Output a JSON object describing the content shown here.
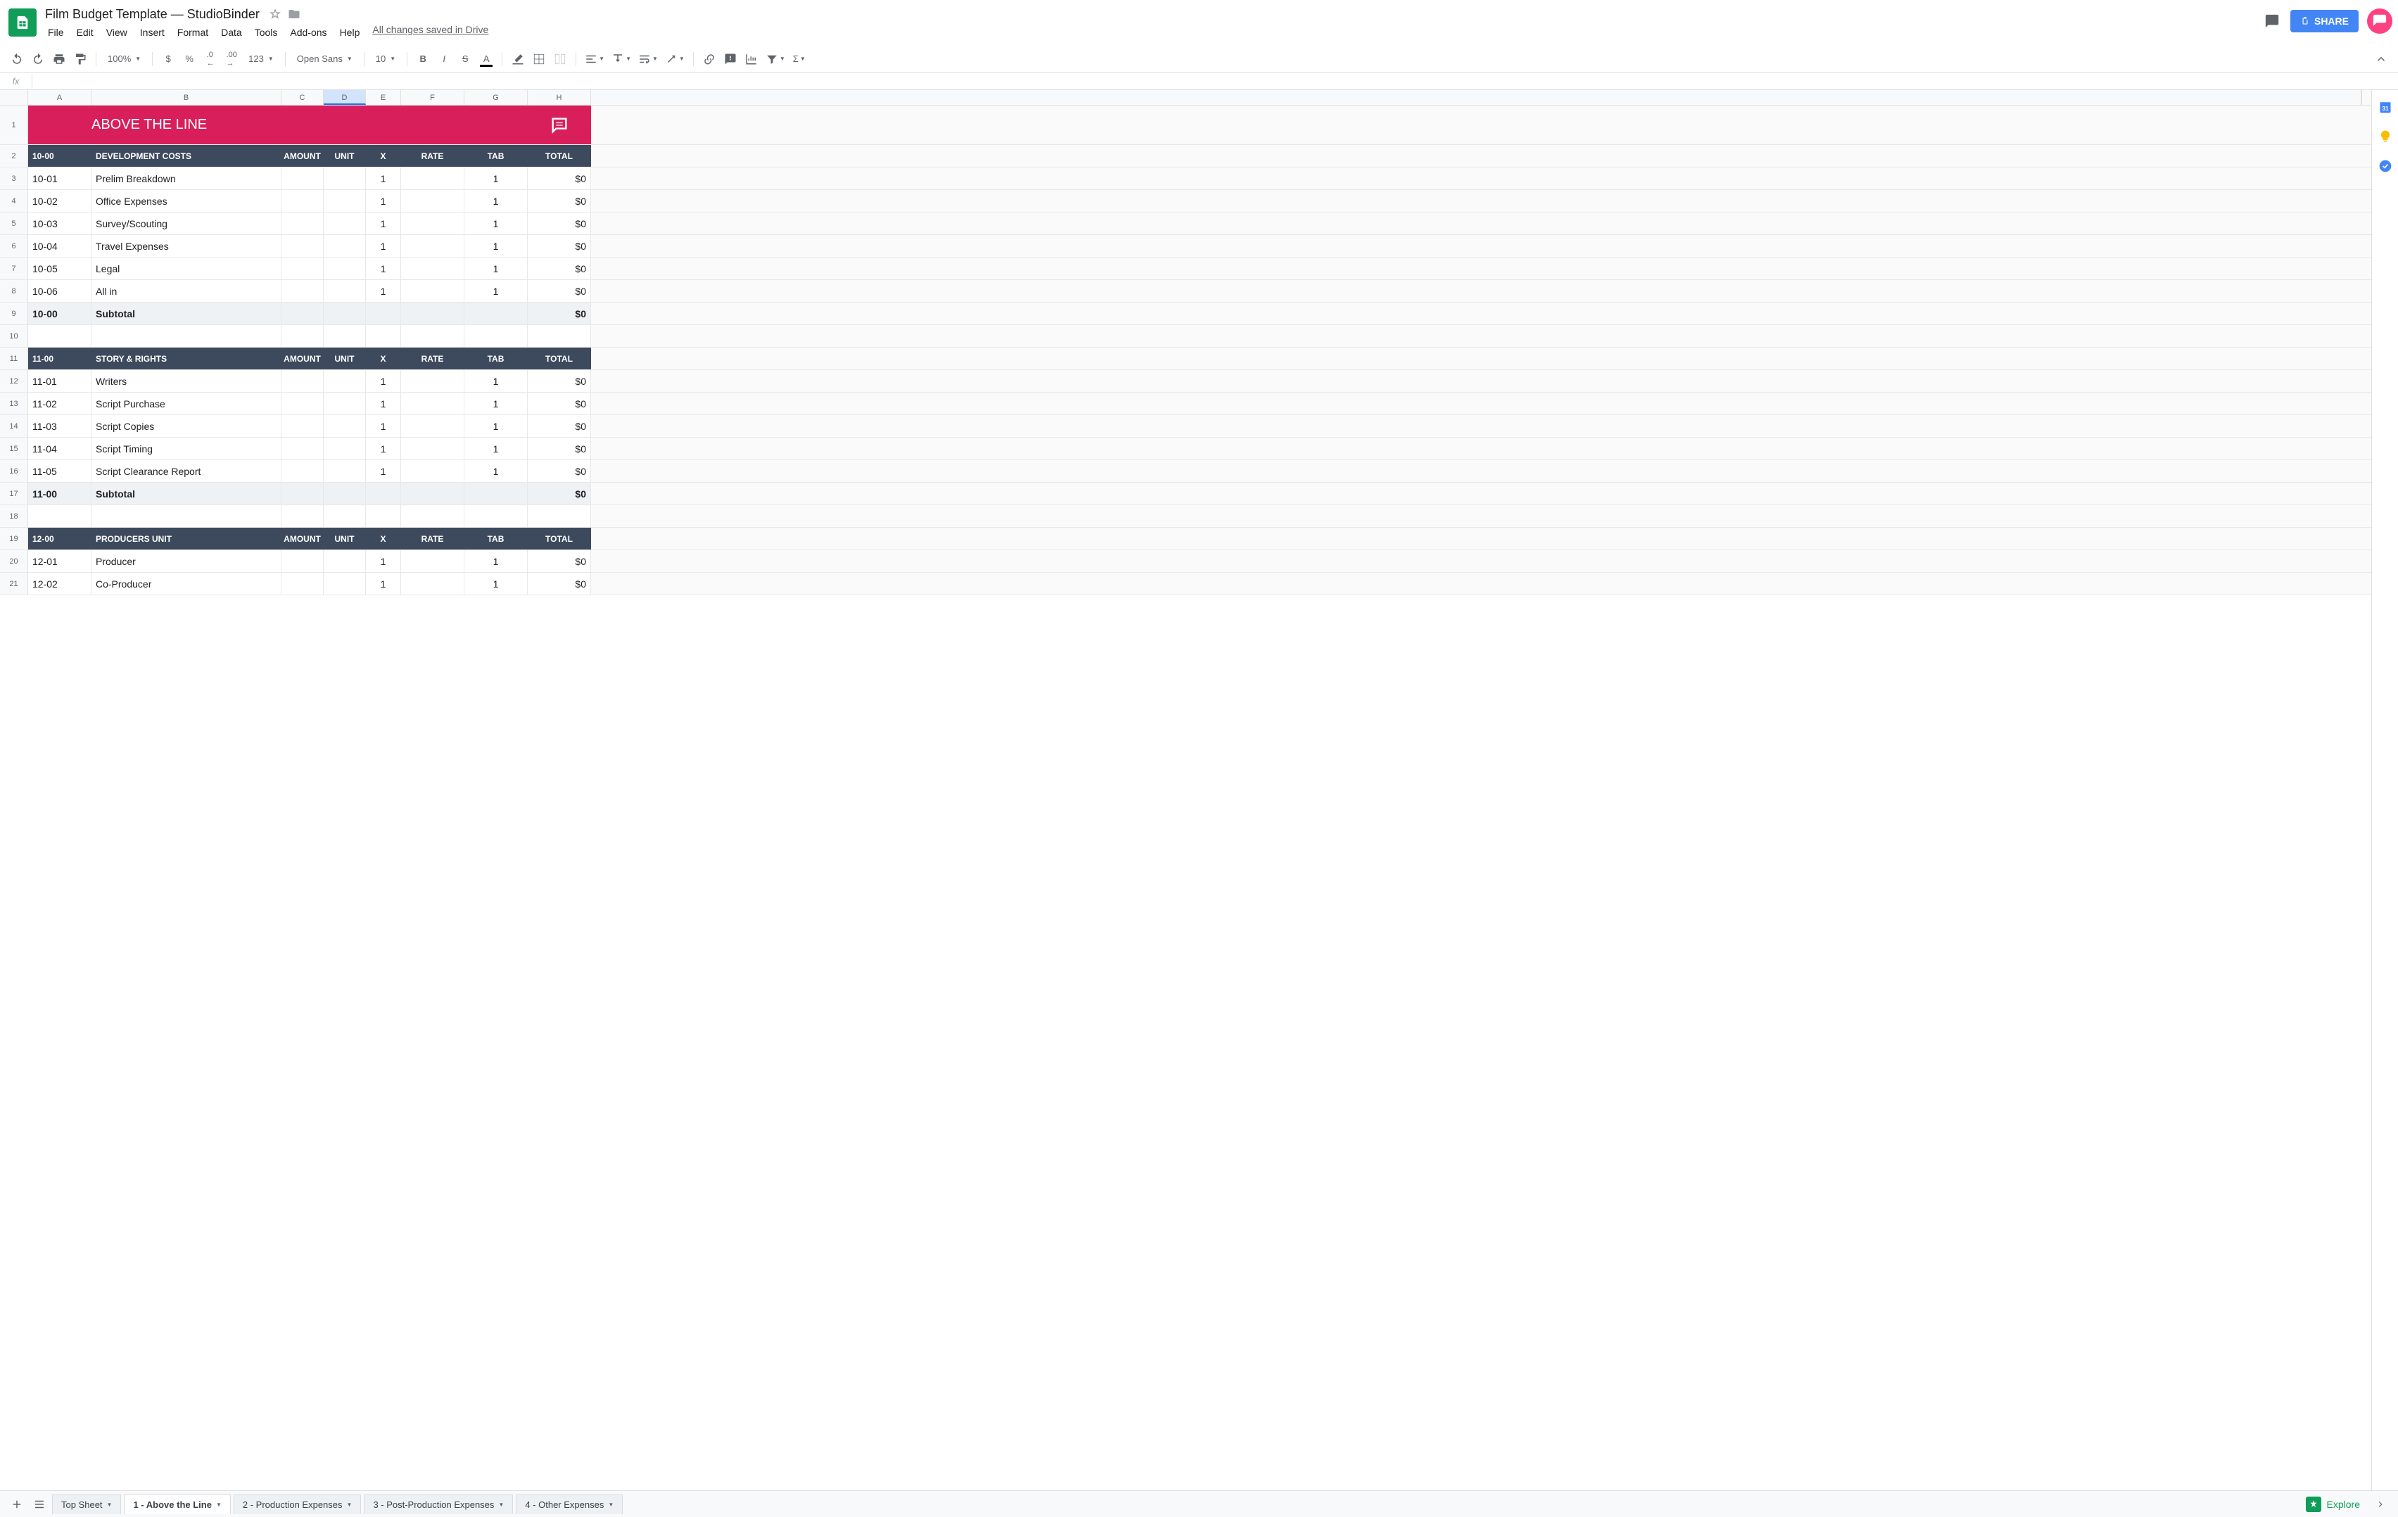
{
  "doc": {
    "title": "Film Budget Template — StudioBinder",
    "saved": "All changes saved in Drive"
  },
  "menus": [
    "File",
    "Edit",
    "View",
    "Insert",
    "Format",
    "Data",
    "Tools",
    "Add-ons",
    "Help"
  ],
  "share_label": "SHARE",
  "toolbar": {
    "zoom": "100%",
    "font": "Open Sans",
    "fontsize": "10"
  },
  "columns": [
    "A",
    "B",
    "C",
    "D",
    "E",
    "F",
    "G",
    "H"
  ],
  "selected_col": "D",
  "explore_label": "Explore",
  "sheet_tabs": [
    {
      "label": "Top Sheet",
      "active": false
    },
    {
      "label": "1 - Above the Line",
      "active": true
    },
    {
      "label": "2 - Production Expenses",
      "active": false
    },
    {
      "label": "3 - Post-Production Expenses",
      "active": false
    },
    {
      "label": "4 - Other Expenses",
      "active": false
    }
  ],
  "section_title": "ABOVE THE LINE",
  "headers": {
    "amount": "AMOUNT",
    "unit": "UNIT",
    "x": "X",
    "rate": "RATE",
    "tab": "TAB",
    "total": "TOTAL"
  },
  "rows": [
    {
      "n": 1,
      "type": "pink"
    },
    {
      "n": 2,
      "type": "dark",
      "code": "10-00",
      "desc": "DEVELOPMENT COSTS"
    },
    {
      "n": 3,
      "type": "data",
      "code": "10-01",
      "desc": "Prelim Breakdown",
      "x": "1",
      "tab": "1",
      "total": "$0"
    },
    {
      "n": 4,
      "type": "data",
      "code": "10-02",
      "desc": "Office Expenses",
      "x": "1",
      "tab": "1",
      "total": "$0"
    },
    {
      "n": 5,
      "type": "data",
      "code": "10-03",
      "desc": "Survey/Scouting",
      "x": "1",
      "tab": "1",
      "total": "$0"
    },
    {
      "n": 6,
      "type": "data",
      "code": "10-04",
      "desc": "Travel Expenses",
      "x": "1",
      "tab": "1",
      "total": "$0"
    },
    {
      "n": 7,
      "type": "data",
      "code": "10-05",
      "desc": "Legal",
      "x": "1",
      "tab": "1",
      "total": "$0"
    },
    {
      "n": 8,
      "type": "data",
      "code": "10-06",
      "desc": "All in",
      "x": "1",
      "tab": "1",
      "total": "$0"
    },
    {
      "n": 9,
      "type": "sub",
      "code": "10-00",
      "desc": "Subtotal",
      "total": "$0"
    },
    {
      "n": 10,
      "type": "blank"
    },
    {
      "n": 11,
      "type": "dark",
      "code": "11-00",
      "desc": "STORY & RIGHTS"
    },
    {
      "n": 12,
      "type": "data",
      "code": "11-01",
      "desc": "Writers",
      "x": "1",
      "tab": "1",
      "total": "$0"
    },
    {
      "n": 13,
      "type": "data",
      "code": "11-02",
      "desc": "Script Purchase",
      "x": "1",
      "tab": "1",
      "total": "$0"
    },
    {
      "n": 14,
      "type": "data",
      "code": "11-03",
      "desc": "Script Copies",
      "x": "1",
      "tab": "1",
      "total": "$0"
    },
    {
      "n": 15,
      "type": "data",
      "code": "11-04",
      "desc": "Script Timing",
      "x": "1",
      "tab": "1",
      "total": "$0"
    },
    {
      "n": 16,
      "type": "data",
      "code": "11-05",
      "desc": "Script Clearance Report",
      "x": "1",
      "tab": "1",
      "total": "$0"
    },
    {
      "n": 17,
      "type": "sub",
      "code": "11-00",
      "desc": "Subtotal",
      "total": "$0"
    },
    {
      "n": 18,
      "type": "blank"
    },
    {
      "n": 19,
      "type": "dark",
      "code": "12-00",
      "desc": "PRODUCERS UNIT"
    },
    {
      "n": 20,
      "type": "data",
      "code": "12-01",
      "desc": "Producer",
      "x": "1",
      "tab": "1",
      "total": "$0"
    },
    {
      "n": 21,
      "type": "data",
      "code": "12-02",
      "desc": "Co-Producer",
      "x": "1",
      "tab": "1",
      "total": "$0"
    }
  ]
}
